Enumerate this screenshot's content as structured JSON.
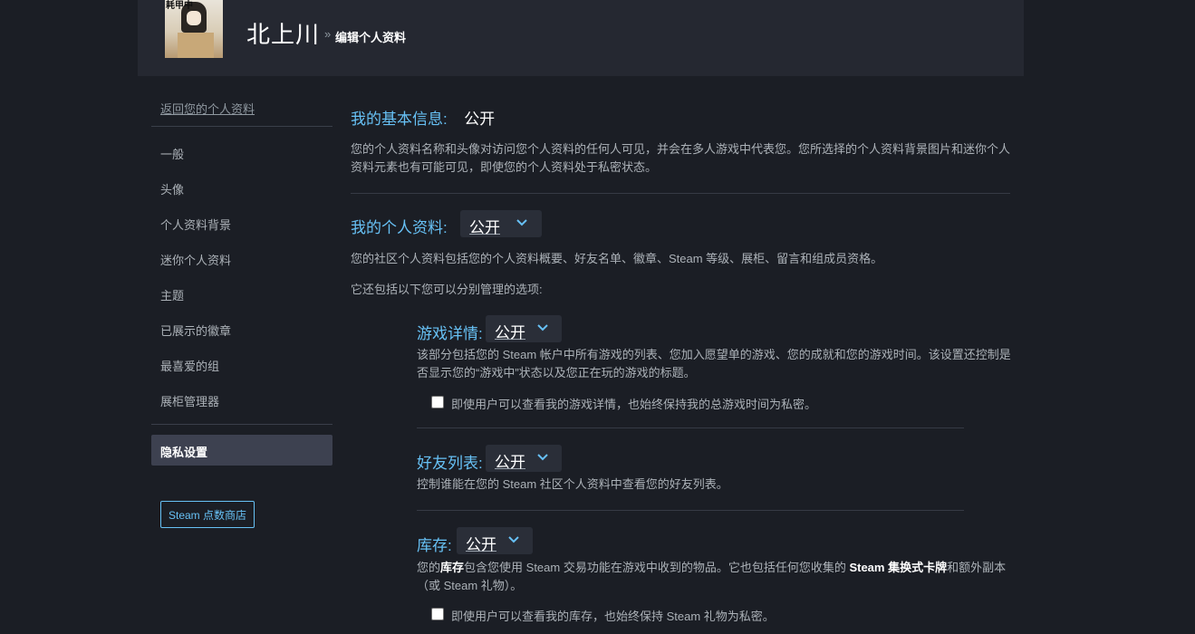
{
  "header": {
    "avatar_text": "耗甲中",
    "username": "北上川",
    "breadcrumb_separator": "»",
    "breadcrumb": "编辑个人资料"
  },
  "sidebar": {
    "back_link": "返回您的个人资料",
    "items": [
      "一般",
      "头像",
      "个人资料背景",
      "迷你个人资料",
      "主题",
      "已展示的徽章",
      "最喜爱的组",
      "展柜管理器"
    ],
    "active_item": "隐私设置",
    "points_shop": "Steam 点数商店"
  },
  "privacy": {
    "basic_info": {
      "label": "我的基本信息:",
      "value": "公开",
      "desc": "您的个人资料名称和头像对访问您个人资料的任何人可见，并会在多人游戏中代表您。您所选择的个人资料背景图片和迷你个人资料元素也有可能可见，即使您的个人资料处于私密状态。"
    },
    "profile": {
      "label": "我的个人资料:",
      "value": "公开",
      "desc": "您的社区个人资料包括您的个人资料概要、好友名单、徽章、Steam 等级、展柜、留言和组成员资格。",
      "desc2": "它还包括以下您可以分别管理的选项:"
    },
    "game_details": {
      "label": "游戏详情:",
      "value": "公开",
      "desc": "该部分包括您的 Steam 帐户中所有游戏的列表、您加入愿望单的游戏、您的成就和您的游戏时间。该设置还控制是否显示您的“游戏中”状态以及您正在玩的游戏的标题。",
      "checkbox_label": "即使用户可以查看我的游戏详情，也始终保持我的总游戏时间为私密。"
    },
    "friends_list": {
      "label": "好友列表:",
      "value": "公开",
      "desc": "控制谁能在您的 Steam 社区个人资料中查看您的好友列表。"
    },
    "inventory": {
      "label": "库存:",
      "value": "公开",
      "desc_1": "您的",
      "desc_bold_1": "库存",
      "desc_2": "包含您使用 Steam 交易功能在游戏中收到的物品。它也包括任何您收集的",
      "desc_bold_2": "Steam 集换式卡牌",
      "desc_3": "和额外副本（或 Steam 礼物）。",
      "checkbox_label": "即使用户可以查看我的库存，也始终保持 Steam 礼物为私密。"
    }
  },
  "colors": {
    "accent": "#67c1f5",
    "background": "#1b1e25",
    "header_bg": "#252831"
  }
}
